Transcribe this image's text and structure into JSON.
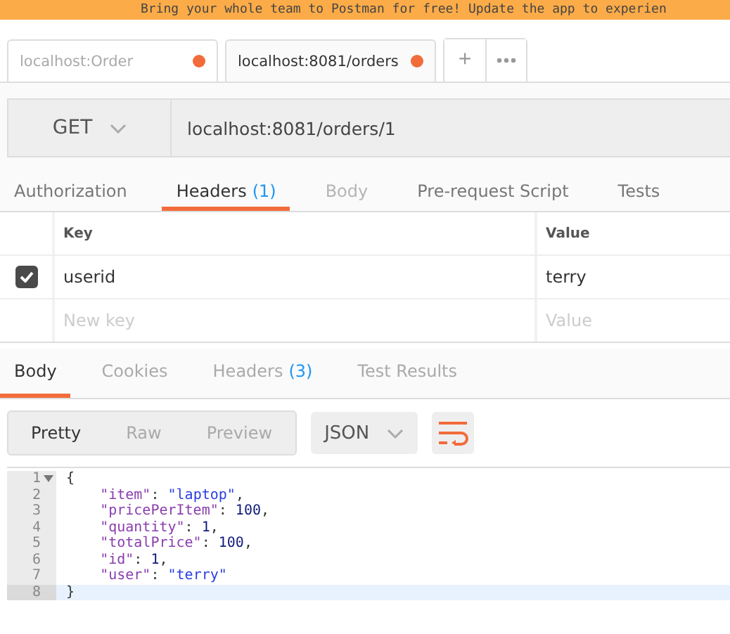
{
  "banner": {
    "text": "Bring your whole team to Postman for free! Update the app to experien"
  },
  "tabs": [
    {
      "label": "localhost:Order",
      "selected": false,
      "unsaved": true
    },
    {
      "label": "localhost:8081/orders",
      "selected": true,
      "unsaved": true
    }
  ],
  "tab_actions": {
    "add": "+"
  },
  "request": {
    "method": "GET",
    "url": "localhost:8081/orders/1"
  },
  "request_tabs": [
    {
      "label": "Authorization",
      "selected": false,
      "disabled": false
    },
    {
      "label": "Headers",
      "count": "(1)",
      "selected": true,
      "disabled": false
    },
    {
      "label": "Body",
      "selected": false,
      "disabled": true
    },
    {
      "label": "Pre-request Script",
      "selected": false,
      "disabled": false
    },
    {
      "label": "Tests",
      "selected": false,
      "disabled": false
    }
  ],
  "headers": {
    "columns": [
      "Key",
      "Value"
    ],
    "rows": [
      {
        "key": "userid",
        "value": "terry",
        "checked": true
      }
    ],
    "new_row": {
      "key_placeholder": "New key",
      "value_placeholder": "Value"
    }
  },
  "response_tabs": [
    {
      "label": "Body",
      "selected": true
    },
    {
      "label": "Cookies",
      "selected": false
    },
    {
      "label": "Headers",
      "count": "(3)",
      "selected": false
    },
    {
      "label": "Test Results",
      "selected": false
    }
  ],
  "view_modes": [
    {
      "label": "Pretty",
      "selected": true
    },
    {
      "label": "Raw",
      "selected": false
    },
    {
      "label": "Preview",
      "selected": false
    }
  ],
  "format": "JSON",
  "code": [
    {
      "number": "1",
      "tokens": [
        {
          "text": "{",
          "kind": "punct"
        }
      ],
      "current": false
    },
    {
      "number": "2",
      "tokens": [
        {
          "text": "    \"item\"",
          "kind": "key"
        },
        {
          "text": ": ",
          "kind": "punct"
        },
        {
          "text": "\"laptop\"",
          "kind": "string"
        },
        {
          "text": ",",
          "kind": "punct"
        }
      ],
      "current": false
    },
    {
      "number": "3",
      "tokens": [
        {
          "text": "    \"pricePerItem\"",
          "kind": "key"
        },
        {
          "text": ": ",
          "kind": "punct"
        },
        {
          "text": "100",
          "kind": "number"
        },
        {
          "text": ",",
          "kind": "punct"
        }
      ],
      "current": false
    },
    {
      "number": "4",
      "tokens": [
        {
          "text": "    \"quantity\"",
          "kind": "key"
        },
        {
          "text": ": ",
          "kind": "punct"
        },
        {
          "text": "1",
          "kind": "number"
        },
        {
          "text": ",",
          "kind": "punct"
        }
      ],
      "current": false
    },
    {
      "number": "5",
      "tokens": [
        {
          "text": "    \"totalPrice\"",
          "kind": "key"
        },
        {
          "text": ": ",
          "kind": "punct"
        },
        {
          "text": "100",
          "kind": "number"
        },
        {
          "text": ",",
          "kind": "punct"
        }
      ],
      "current": false
    },
    {
      "number": "6",
      "tokens": [
        {
          "text": "    \"id\"",
          "kind": "key"
        },
        {
          "text": ": ",
          "kind": "punct"
        },
        {
          "text": "1",
          "kind": "number"
        },
        {
          "text": ",",
          "kind": "punct"
        }
      ],
      "current": false
    },
    {
      "number": "7",
      "tokens": [
        {
          "text": "    \"user\"",
          "kind": "key"
        },
        {
          "text": ": ",
          "kind": "punct"
        },
        {
          "text": "\"terry\"",
          "kind": "string"
        }
      ],
      "current": false
    },
    {
      "number": "8",
      "tokens": [
        {
          "text": "}",
          "kind": "punct"
        }
      ],
      "current": true
    }
  ]
}
